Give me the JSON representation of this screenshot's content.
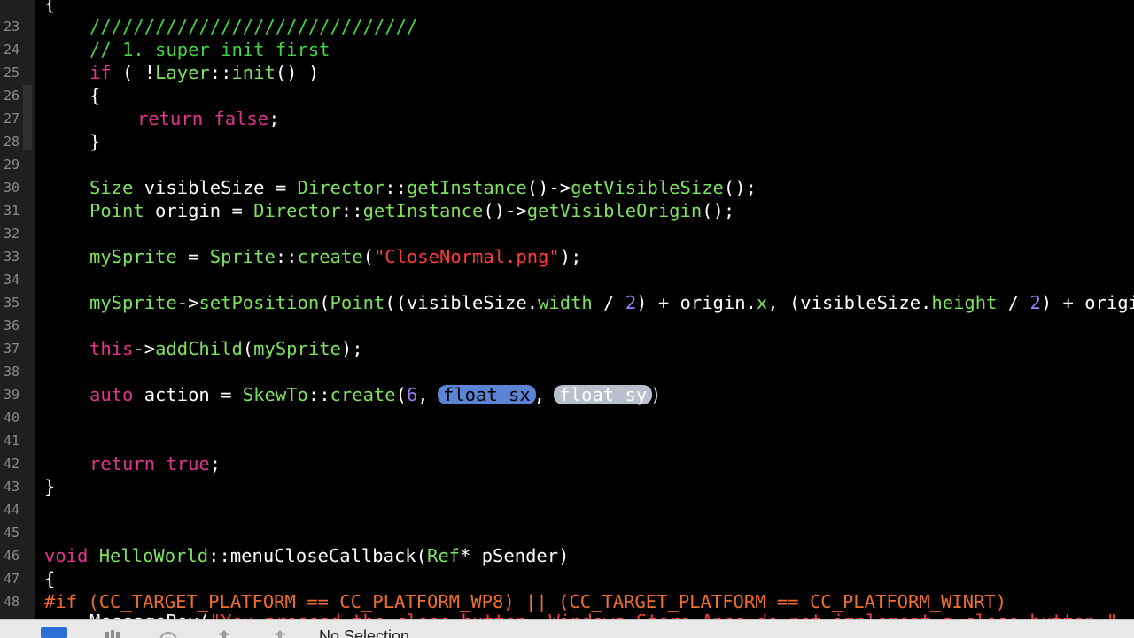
{
  "editor": {
    "line_numbers": [
      "23",
      "24",
      "25",
      "26",
      "27",
      "28",
      "29",
      "30",
      "31",
      "32",
      "33",
      "34",
      "35",
      "36",
      "37",
      "38",
      "39",
      "40",
      "41",
      "42",
      "43",
      "44",
      "45",
      "46",
      "47",
      "48"
    ],
    "lines": {
      "l22": "{",
      "l23": "//////////////////////////////",
      "l24": "// 1. super init first",
      "l25": {
        "a": "if",
        "b": " ( !",
        "c": "Layer",
        "d": "::",
        "e": "init",
        "f": "() )"
      },
      "l26": "{",
      "l27": {
        "a": "return",
        "b": " ",
        "c": "false",
        "d": ";"
      },
      "l28": "}",
      "l30": {
        "a": "Size",
        "b": " visibleSize = ",
        "c": "Director",
        "d": "::",
        "e": "getInstance",
        "f": "()->",
        "g": "getVisibleSize",
        "h": "();"
      },
      "l31": {
        "a": "Point",
        "b": " origin = ",
        "c": "Director",
        "d": "::",
        "e": "getInstance",
        "f": "()->",
        "g": "getVisibleOrigin",
        "h": "();"
      },
      "l33": {
        "a": "mySprite",
        "b": " = ",
        "c": "Sprite",
        "d": "::",
        "e": "create",
        "f": "(",
        "g": "\"CloseNormal.png\"",
        "h": ");"
      },
      "l35": {
        "a": "mySprite",
        "b": "->",
        "c": "setPosition",
        "d": "(",
        "e": "Point",
        "f": "((visibleSize.",
        "g": "width",
        "h": " / ",
        "i": "2",
        "j": ") + origin.",
        "k": "x",
        "l": ", (visibleSize.",
        "m": "height",
        "n": " / ",
        "o": "2",
        "p": ") + origin.y));"
      },
      "l37": {
        "a": "this",
        "b": "->",
        "c": "addChild",
        "d": "(",
        "e": "mySprite",
        "f": ");"
      },
      "l39": {
        "a": "auto",
        "b": " action = ",
        "c": "SkewTo",
        "d": "::",
        "e": "create",
        "f": "(",
        "g": "6",
        "h": ", ",
        "ph1": "float sx",
        "i": ", ",
        "ph2": "float sy",
        "j": ")"
      },
      "l42": {
        "a": "return",
        "b": " ",
        "c": "true",
        "d": ";"
      },
      "l43": "}",
      "l46": {
        "a": "void",
        "b": " ",
        "c": "HelloWorld",
        "d": "::menuCloseCallback(",
        "e": "Ref",
        "f": "* pSender)"
      },
      "l47": "{",
      "l48": "#if (CC_TARGET_PLATFORM == CC_PLATFORM_WP8) || (CC_TARGET_PLATFORM == CC_PLATFORM_WINRT)",
      "l49": {
        "a": "MessageBox",
        "b": "(",
        "c": "\"You pressed the close button. Windows Store Apps do not implement a close button.\""
      }
    }
  },
  "statusbar": {
    "label": "No Selection",
    "icons": [
      "navigator-icon",
      "grid-icon",
      "refresh-icon",
      "upload-icon",
      "folder-up-icon"
    ]
  }
}
